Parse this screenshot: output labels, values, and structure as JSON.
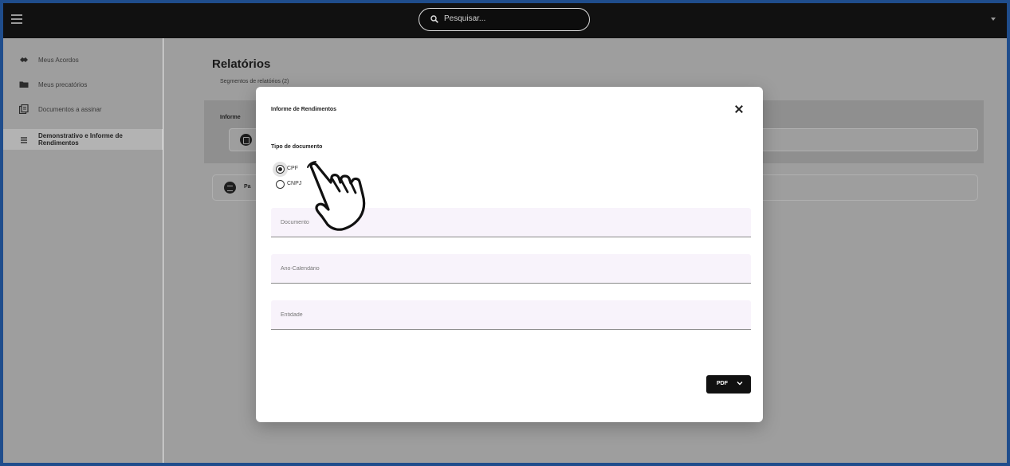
{
  "topbar": {
    "search_placeholder": "Pesquisar..."
  },
  "sidebar": {
    "items": [
      {
        "label": "Meus Acordos",
        "icon": "handshake-icon"
      },
      {
        "label": "Meus precatórios",
        "icon": "folder-icon"
      },
      {
        "label": "Documentos a assinar",
        "icon": "documents-icon"
      },
      {
        "label": "Demonstrativo e Informe de Rendimentos",
        "icon": "list-icon",
        "active": true
      }
    ]
  },
  "main": {
    "title": "Relatórios",
    "segments_label": "Segmentos de relatórios (2)",
    "report_card_title": "Informe",
    "second_row_label": "Pa"
  },
  "modal": {
    "title": "Informe de Rendimentos",
    "doc_type_label": "Tipo de documento",
    "radio_options": [
      {
        "label": "CPF",
        "selected": true
      },
      {
        "label": "CNPJ",
        "selected": false
      }
    ],
    "fields": {
      "documento": {
        "placeholder": "Documento",
        "value": ""
      },
      "ano_calendario": {
        "placeholder": "Ano-Calendário",
        "value": ""
      },
      "entidade": {
        "placeholder": "Entidade",
        "value": ""
      }
    },
    "export_button": "PDF"
  },
  "colors": {
    "topbar": "#111111",
    "overlay_gray": "#9e9e9e",
    "field_bg": "#f8f3fb",
    "frame_border": "#1f4d8c"
  }
}
